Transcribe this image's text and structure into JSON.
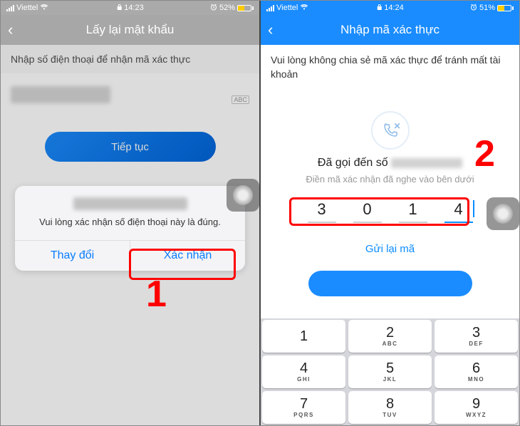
{
  "left": {
    "status": {
      "carrier": "Viettel",
      "time": "14:23",
      "battery": "52%"
    },
    "nav_title": "Lấy lại mật khẩu",
    "instruction": "Nhập số điện thoại để nhận mã xác thực",
    "abc": "ABC",
    "continue_label": "Tiếp tục",
    "dialog": {
      "message": "Vui lòng xác nhận số điện thoại này là đúng.",
      "change": "Thay đổi",
      "confirm": "Xác nhận"
    },
    "step": "1"
  },
  "right": {
    "status": {
      "carrier": "Viettel",
      "time": "14:24",
      "battery": "51%"
    },
    "nav_title": "Nhập mã xác thực",
    "instruction": "Vui lòng không chia sẻ mã xác thực để tránh mất tài khoản",
    "called_to": "Đã gọi đến số",
    "enter_code": "Điền mã xác nhận đã nghe vào bên dưới",
    "code": [
      "3",
      "0",
      "1",
      "4"
    ],
    "resend": "Gửi lại mã",
    "step": "2",
    "keys": [
      [
        "1",
        ""
      ],
      [
        "2",
        "ABC"
      ],
      [
        "3",
        "DEF"
      ],
      [
        "4",
        "GHI"
      ],
      [
        "5",
        "JKL"
      ],
      [
        "6",
        "MNO"
      ],
      [
        "7",
        "PQRS"
      ],
      [
        "8",
        "TUV"
      ],
      [
        "9",
        "WXYZ"
      ]
    ]
  }
}
